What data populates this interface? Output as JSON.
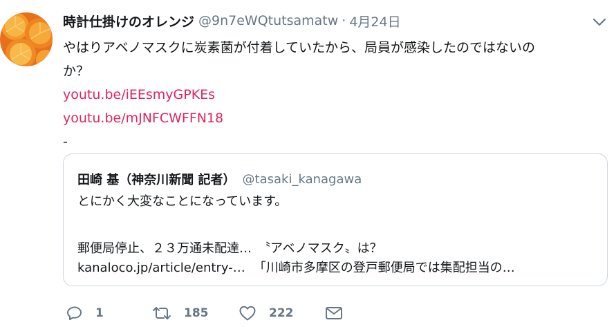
{
  "tweet": {
    "display_name": "時計仕掛けのオレンジ",
    "handle": "@9n7eWQtutsamatw",
    "separator": "·",
    "date": "4月24日",
    "text_line1": "やはりアベノマスクに炭素菌が付着していたから、局員が感染したのではないの",
    "text_line2": "か？",
    "link1": "youtu.be/iEEsmyGPKEs",
    "link2": "youtu.be/mJNFCWFFN18",
    "text_tail": "-"
  },
  "quote": {
    "name": "田崎 基（神奈川新聞 記者）",
    "handle": "@tasaki_kanagawa",
    "text": "とにかく大変なことになっています。",
    "card_title": "郵便局停止、２３万通未配達…　〝アベノマスク〟は？",
    "card_url": "kanaloco.jp/article/entry-…",
    "card_desc": "「川崎市多摩区の登戸郵便局では集配担当の…"
  },
  "actions": {
    "reply_count": "1",
    "retweet_count": "185",
    "like_count": "222"
  },
  "icons": {
    "avatar": "orange-avatar",
    "caret": "chevron-down-icon",
    "reply": "reply-icon",
    "retweet": "retweet-icon",
    "like": "heart-icon",
    "dm": "envelope-icon"
  },
  "colors": {
    "link": "#e0245e",
    "secondary": "#657786",
    "border": "#ccd6dd",
    "text": "#14171a"
  }
}
